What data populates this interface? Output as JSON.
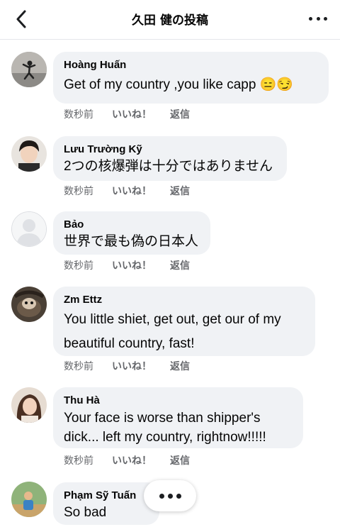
{
  "header": {
    "title": "久田 健の投稿"
  },
  "comments": [
    {
      "author": "Hoàng Huấn",
      "text": "Get of my country ,you like capp 😑😏",
      "time": "数秒前",
      "like": "いいね！",
      "reply": "返信"
    },
    {
      "author": "Lưu Trường Kỹ",
      "text": "2つの核爆弾は十分ではありません",
      "time": "数秒前",
      "like": "いいね！",
      "reply": "返信"
    },
    {
      "author": "Bảo",
      "text": "世界で最も偽の日本人",
      "time": "数秒前",
      "like": "いいね！",
      "reply": "返信"
    },
    {
      "author": "Zm Ettz",
      "text_line1": "You little shiet, get out, get our of my",
      "text_line2": "beautiful country, fast!",
      "time": "数秒前",
      "like": "いいね！",
      "reply": "返信"
    },
    {
      "author": "Thu Hà",
      "text_line1": "Your face is worse than shipper's",
      "text_line2": "dick... left my country, rightnow!!!!!",
      "time": "数秒前",
      "like": "いいね！",
      "reply": "返信"
    },
    {
      "author": "Phạm Sỹ Tuấn",
      "text": "So bad"
    }
  ],
  "colors": {
    "bubble": "#f0f2f5",
    "meta_text": "#65676b",
    "divider": "#e4e6eb"
  }
}
